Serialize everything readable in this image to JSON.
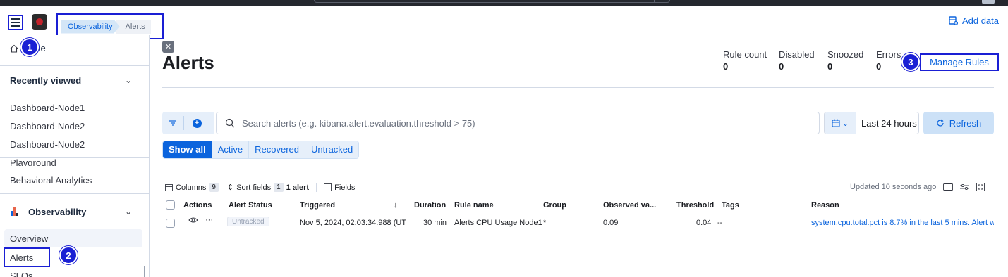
{
  "header": {
    "breadcrumbs": [
      "Observability",
      "Alerts"
    ],
    "add_data": "Add data"
  },
  "sidebar": {
    "home": "Home",
    "recently_viewed": {
      "title": "Recently viewed",
      "items": [
        "Dashboard-Node1",
        "Dashboard-Node2",
        "Dashboard-Node2"
      ]
    },
    "extra_items": [
      "Playground",
      "Behavioral Analytics"
    ],
    "observability": {
      "title": "Observability",
      "items": [
        "Overview",
        "Alerts",
        "SLOs"
      ]
    }
  },
  "annotations": [
    "1",
    "2",
    "3"
  ],
  "page": {
    "title": "Alerts",
    "stats": [
      {
        "label": "Rule count",
        "value": "0"
      },
      {
        "label": "Disabled",
        "value": "0"
      },
      {
        "label": "Snoozed",
        "value": "0"
      },
      {
        "label": "Errors",
        "value": "0"
      }
    ],
    "manage_rules": "Manage Rules"
  },
  "search": {
    "placeholder": "Search alerts (e.g. kibana.alert.evaluation.threshold > 75)",
    "date_range": "Last 24 hours",
    "refresh": "Refresh"
  },
  "status_tabs": [
    "Show all",
    "Active",
    "Recovered",
    "Untracked"
  ],
  "toolbar": {
    "columns": "Columns",
    "columns_count": "9",
    "sort_fields": "Sort fields",
    "sort_count": "1",
    "alert_count": "1 alert",
    "fields": "Fields",
    "updated": "Updated 10 seconds ago"
  },
  "table": {
    "headers": [
      "Actions",
      "Alert Status",
      "Triggered",
      "Duration",
      "Rule name",
      "Group",
      "Observed va...",
      "Threshold",
      "Tags",
      "Reason"
    ],
    "rows": [
      {
        "status": "Untracked",
        "triggered": "Nov 5, 2024, 02:03:34.988 (UT",
        "duration": "30 min",
        "rule_name": "Alerts CPU Usage Node1",
        "group": "*",
        "observed": "0.09",
        "threshold": "0.04",
        "tags": "--",
        "reason": "system.cpu.total.pct is 8.7% in the last 5 mins. Alert w"
      }
    ]
  },
  "colors": {
    "accent": "#0b64dd",
    "annotation": "#1a1fd4",
    "header_dark": "#25282f"
  }
}
